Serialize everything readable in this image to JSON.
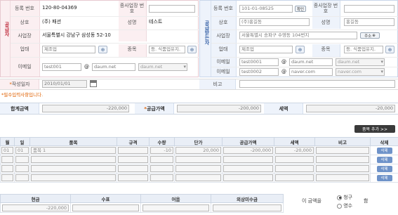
{
  "supplier": {
    "side_label": "공급자",
    "reg_no_label": "등록 번호",
    "reg_no": "120-80-04369",
    "sub_biz_label": "종사업장 번호",
    "company_label": "상호",
    "company": "(주) 패션",
    "name_label": "성명",
    "name": "테스트",
    "address_label": "사업장",
    "address": "서울특별시 강남구 삼성동 52-10",
    "biz_type_label": "업태",
    "biz_type_placeholder": "제조업",
    "biz_item_label": "종목",
    "biz_item_placeholder": "등. 식품업유지.",
    "email_label": "이메일",
    "email_id": "test001",
    "email_at": "@",
    "email_domain": "daum.net",
    "email_select": "daum.net"
  },
  "receiver": {
    "side_label": "공급받는자",
    "reg_no_label": "등록 번호",
    "reg_no": "101-01-08525",
    "confirm_button": "확인",
    "sub_biz_label": "종사업장 번호",
    "company_label": "상호",
    "company": "(주)홍길동",
    "name_label": "성명",
    "name": "홍길동",
    "address_label": "사업장",
    "address": "서울특별시 송파구 수영동 104번지",
    "address_button": "주소",
    "biz_type_label": "업태",
    "biz_type": "제조업",
    "biz_item_label": "종목",
    "biz_item_placeholder": "등. 식품업유지.",
    "email_label": "이메일",
    "email_id": "test0001",
    "email_at": "@",
    "email_domain": "daum.net",
    "email_select": "daum.net",
    "email2_label": "이메일",
    "email2_id": "test0002",
    "email2_at": "@",
    "email2_domain": "naver.com",
    "email2_select": "naver.com"
  },
  "issue": {
    "date_label": "작성일자",
    "date": "2010/01/01",
    "note_label": "비고",
    "required_notice": "필수입력사항입니다."
  },
  "totals": {
    "total_label": "합계금액",
    "total": "-220,000",
    "supply_label": "공급가액",
    "supply": "-200,000",
    "tax_label": "세액",
    "tax": "-20,000",
    "add_item_button": "품목 추가 >>"
  },
  "items": {
    "headers": [
      "월",
      "일",
      "품목",
      "규격",
      "수량",
      "단가",
      "공급가액",
      "세액",
      "비고",
      "삭제"
    ],
    "rows": [
      {
        "month": "01",
        "day": "01",
        "item": "품목 1",
        "spec": "",
        "qty": "-10",
        "price": "20,000",
        "supply": "-200,000",
        "tax": "-20,000",
        "note": "",
        "delete": "삭제"
      },
      {
        "month": "",
        "day": "",
        "item": "",
        "spec": "",
        "qty": "",
        "price": "",
        "supply": "",
        "tax": "",
        "note": "",
        "delete": "삭제"
      },
      {
        "month": "",
        "day": "",
        "item": "",
        "spec": "",
        "qty": "",
        "price": "",
        "supply": "",
        "tax": "",
        "note": "",
        "delete": "삭제"
      },
      {
        "month": "",
        "day": "",
        "item": "",
        "spec": "",
        "qty": "",
        "price": "",
        "supply": "",
        "tax": "",
        "note": "",
        "delete": "삭제"
      }
    ]
  },
  "payment": {
    "headers": [
      "현금",
      "수표",
      "어음",
      "외상미수금"
    ],
    "cash": "-220,000",
    "check": "",
    "bill": "",
    "credit": "",
    "amount_label": "이 금액을",
    "claim_option": "청구",
    "receipt_option": "영수",
    "suffix": "함"
  },
  "colors": {
    "supplier_bg": "#fbeff1",
    "receiver_bg": "#eef3fb",
    "accent_orange": "#e06000",
    "button_blue": "#6f93c9"
  }
}
